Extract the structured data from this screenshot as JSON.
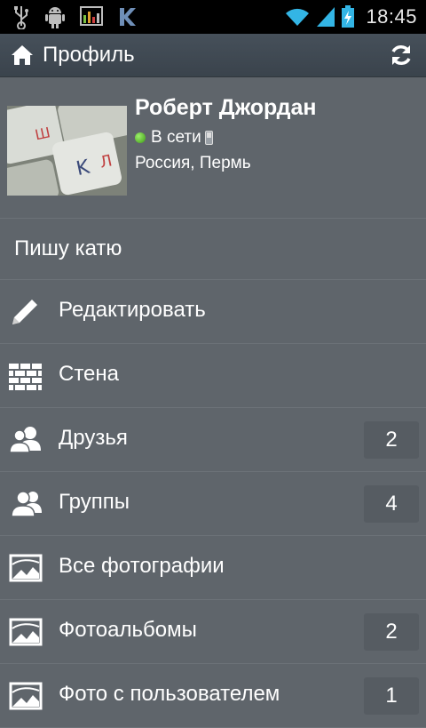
{
  "statusbar": {
    "notification_icons": [
      "usb-icon",
      "android-debug-icon",
      "monitor-icon",
      "vk-app-icon"
    ],
    "system_icons": [
      "wifi-icon",
      "signal-icon",
      "battery-charging-icon"
    ],
    "time": "18:45"
  },
  "actionbar": {
    "title": "Профиль",
    "home_icon": "home-icon",
    "refresh_icon": "refresh-icon"
  },
  "profile": {
    "name": "Роберт Джордан",
    "online_text": "В сети",
    "online_color": "#4fbf22",
    "location": "Россия, Пермь"
  },
  "status_text": "Пишу катю",
  "menu": [
    {
      "label": "Редактировать",
      "icon": "pencil-icon",
      "count": ""
    },
    {
      "label": "Стена",
      "icon": "wall-icon",
      "count": ""
    },
    {
      "label": "Друзья",
      "icon": "friends-icon",
      "count": "2"
    },
    {
      "label": "Группы",
      "icon": "groups-icon",
      "count": "4"
    },
    {
      "label": "Все фотографии",
      "icon": "photos-icon",
      "count": ""
    },
    {
      "label": "Фотоальбомы",
      "icon": "photo-albums-icon",
      "count": "2"
    },
    {
      "label": "Фото с пользователем",
      "icon": "photos-with-user-icon",
      "count": "1"
    }
  ],
  "colors": {
    "background": "#5f656b",
    "actionbar": "#3f4850",
    "badge": "#565c62"
  }
}
